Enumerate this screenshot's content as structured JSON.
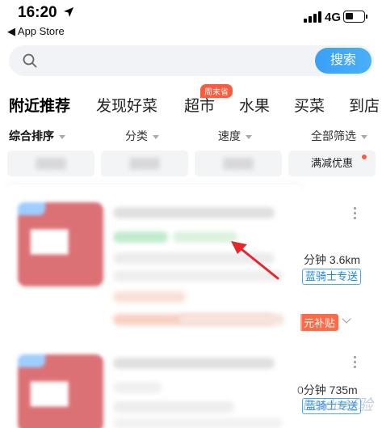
{
  "status_bar": {
    "time": "16:20",
    "back_label": "◀ App Store",
    "network": "4G"
  },
  "search": {
    "placeholder": "",
    "button_label": "搜索"
  },
  "tabs": [
    {
      "label": "附近推荐",
      "active": true
    },
    {
      "label": "发现好菜",
      "active": false
    },
    {
      "label": "超市",
      "active": false,
      "badge": "周末省"
    },
    {
      "label": "水果",
      "active": false
    },
    {
      "label": "买菜",
      "active": false
    },
    {
      "label": "到店",
      "active": false
    }
  ],
  "filters": [
    {
      "label": "综合排序"
    },
    {
      "label": "分类"
    },
    {
      "label": "速度"
    },
    {
      "label": "全部筛选"
    }
  ],
  "chips": [
    {
      "label": "",
      "blurred": true
    },
    {
      "label": "",
      "blurred": true
    },
    {
      "label": "",
      "blurred": true
    },
    {
      "label": "满减优惠",
      "blurred": false,
      "dot": true
    }
  ],
  "cards": [
    {
      "title": "",
      "distance": "分钟 3.6km",
      "delivery_badge": "蓝骑士专送",
      "subsidy": "元补贴"
    },
    {
      "title": "",
      "distance": "0分钟 735m",
      "delivery_badge": "蓝骑士专送"
    }
  ],
  "colors": {
    "accent": "#3aa0f5",
    "badge": "#ff5a3c",
    "annotation_arrow": "#e8262b"
  },
  "watermark": "Baidu经验"
}
